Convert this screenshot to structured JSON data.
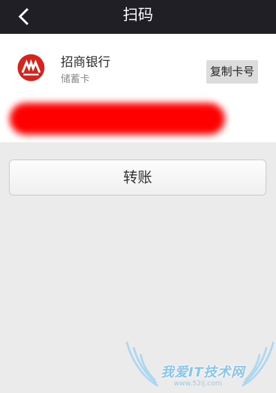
{
  "header": {
    "title": "扫码",
    "back_icon": "chevron-left-icon",
    "background_color": "#1f1f25"
  },
  "card": {
    "bank_name": "招商银行",
    "card_type": "储蓄卡",
    "copy_button_label": "复制卡号",
    "logo_icon": "china-merchants-bank-logo",
    "logo_color": "#d6241d",
    "card_number_redacted": true,
    "redaction_color": "#ff0000"
  },
  "actions": {
    "transfer_button_label": "转账"
  },
  "watermark": {
    "text": "我爱IT技术网",
    "url": "www.52ij.com"
  }
}
